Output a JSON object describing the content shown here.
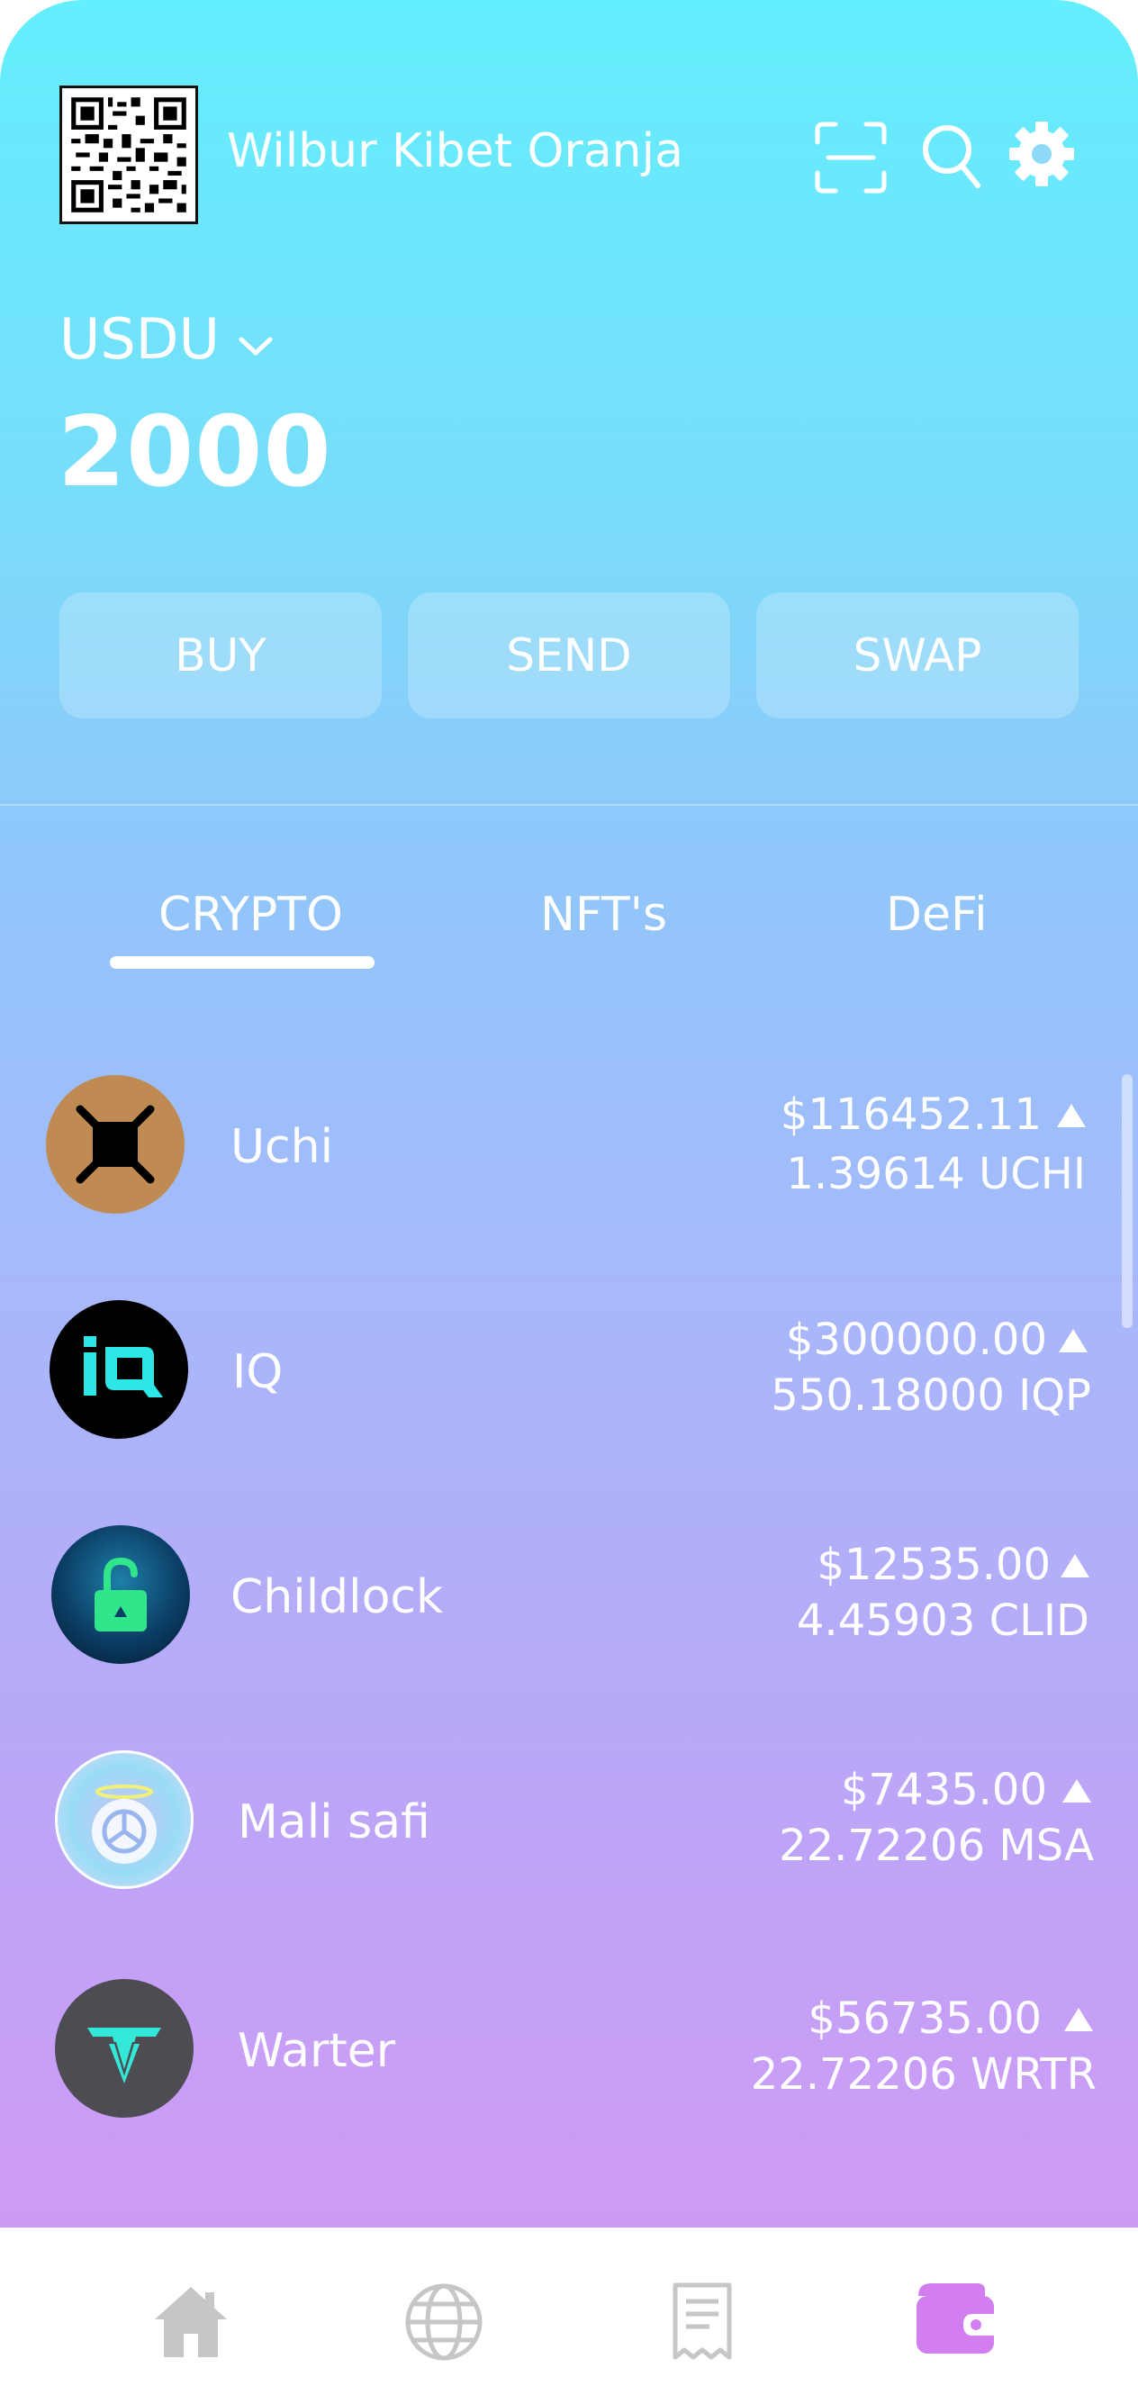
{
  "header": {
    "username": "Wilbur Kibet Oranja"
  },
  "wallet": {
    "currency": "USDU",
    "balance": "2000"
  },
  "actions": {
    "buy": "BUY",
    "send": "SEND",
    "swap": "SWAP"
  },
  "tabs": {
    "crypto": "CRYPTO",
    "nfts": "NFT's",
    "defi": "DeFi",
    "active": "CRYPTO"
  },
  "assets": [
    {
      "name": "Uchi",
      "value": "$116452.11",
      "amount": "1.39614 UCHI",
      "trend": "up"
    },
    {
      "name": "IQ",
      "value": "$300000.00",
      "amount": "550.18000 IQP",
      "trend": "up"
    },
    {
      "name": "Childlock",
      "value": "$12535.00",
      "amount": "4.45903 CLID",
      "trend": "up"
    },
    {
      "name": "Mali safi",
      "value": "$7435.00",
      "amount": "22.72206 MSA",
      "trend": "up"
    },
    {
      "name": "Warter",
      "value": "$56735.00",
      "amount": "22.72206 WRTR",
      "trend": "up"
    }
  ],
  "icons": {
    "header": [
      "qr-code-icon",
      "scan-icon",
      "search-icon",
      "gear-icon"
    ],
    "nav": [
      "home-icon",
      "globe-icon",
      "receipt-icon",
      "wallet-icon"
    ]
  },
  "colors": {
    "nav_active": "#d27ef0",
    "nav_inactive": "#c6c6c6"
  }
}
